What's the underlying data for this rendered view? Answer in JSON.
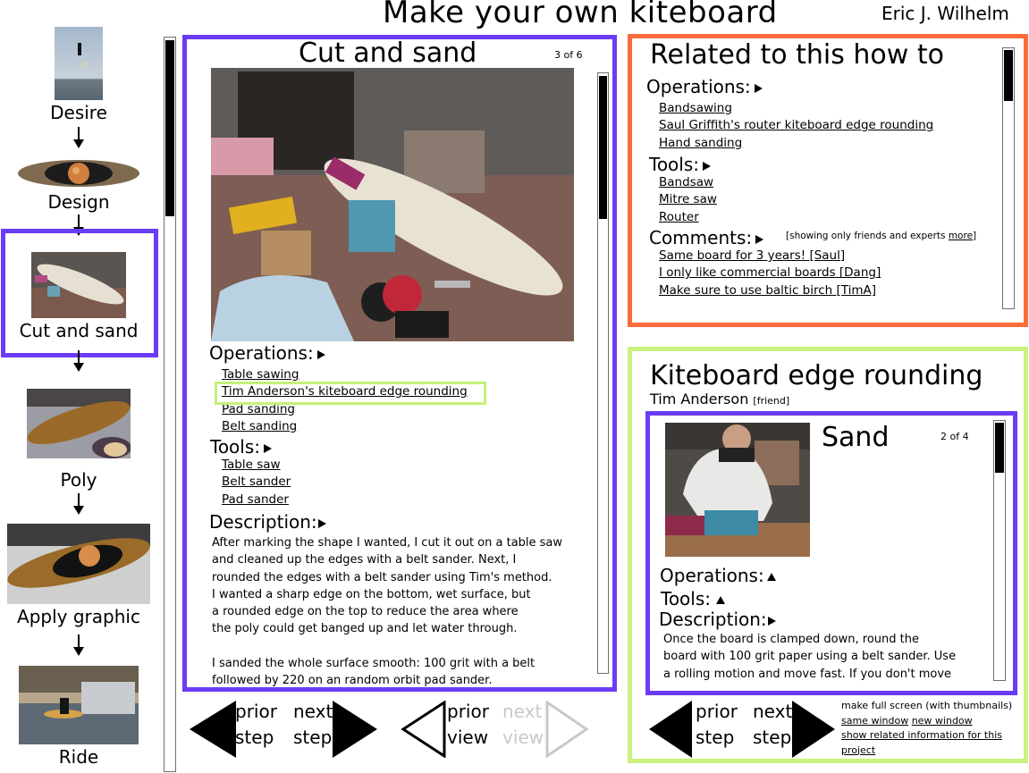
{
  "header": {
    "title": "Make your own kiteboard",
    "author": "Eric J. Wilhelm"
  },
  "steps": [
    {
      "label": "Desire",
      "thumbnail": "kiteboarder-jumping-photo"
    },
    {
      "label": "Design",
      "thumbnail": "board-design-graphic"
    },
    {
      "label": "Cut and sand",
      "thumbnail": "cut-board-photo",
      "current": true
    },
    {
      "label": "Poly",
      "thumbnail": "poly-board-photo"
    },
    {
      "label": "Apply graphic",
      "thumbnail": "graphic-board-photo"
    },
    {
      "label": "Ride",
      "thumbnail": "riding-photo"
    }
  ],
  "step_list_scroll": 0.3,
  "main": {
    "title": "Cut and sand",
    "counter": "3 of 6",
    "photo": "workshop-board-tools-photo",
    "operations_label": "Operations:",
    "operations": [
      "Table sawing",
      "Tim Anderson's kiteboard edge rounding",
      "Pad sanding",
      "Belt sanding"
    ],
    "highlighted_operation": "Tim Anderson's kiteboard edge rounding",
    "tools_label": "Tools:",
    "tools": [
      "Table saw",
      "Belt sander",
      "Pad sander"
    ],
    "description_label": "Description:",
    "description_lines": [
      "After marking the shape I wanted, I cut it out on a table saw",
      "and cleaned up the edges with a belt sander.  Next, I",
      "rounded the edges with a belt sander using Tim's method.",
      "I wanted a sharp edge on the bottom, wet surface, but",
      "a rounded edge on the top to reduce the area where",
      "the poly could get banged up and let water through.",
      "",
      "I sanded the whole surface smooth:  100 grit with a belt",
      "followed by 220 on an random orbit pad  sander."
    ],
    "scroll": 0.2
  },
  "main_nav": {
    "prior_step": [
      "prior",
      "step"
    ],
    "next_step": [
      "next",
      "step"
    ],
    "prior_view": [
      "prior",
      "view"
    ],
    "next_view": [
      "next",
      "view"
    ],
    "next_view_disabled": true
  },
  "related": {
    "title": "Related to this how to",
    "operations_label": "Operations:",
    "operations": [
      "Bandsawing",
      "Saul Griffith's router kiteboard edge rounding",
      "Hand sanding"
    ],
    "tools_label": "Tools:",
    "tools": [
      "Bandsaw",
      "Mitre saw",
      "Router"
    ],
    "comments_label": "Comments:",
    "comments_note": "[showing only friends and experts ",
    "comments_more": "more",
    "comments_note_end": "]",
    "comments": [
      "Same board for 3 years! [Saul]",
      "I only like commercial boards [Dang]",
      "Make sure to use baltic birch [TimA]"
    ],
    "scroll": 0.2
  },
  "kiteboard": {
    "title": "Kiteboard edge rounding",
    "author": "Tim Anderson",
    "author_tag": "[friend]",
    "step_title": "Sand",
    "counter": "2 of 4",
    "photo": "person-belt-sanding-photo",
    "operations_label": "Operations:",
    "tools_label": "Tools:",
    "description_label": "Description:",
    "description_lines": [
      "Once the board is clamped down, round the",
      "board with 100 grit paper using a belt sander.  Use",
      "a rolling motion and move fast.  If you don't move"
    ],
    "scroll": 0.2,
    "nav": {
      "prior_step": [
        "prior",
        "step"
      ],
      "next_step": [
        "next",
        "step"
      ]
    },
    "fullscreen_label": "make full screen (with thumbnails)",
    "same_window": "same window",
    "new_window": "new window",
    "show_related": "show related information for this",
    "show_related_2": "project"
  },
  "colors": {
    "current_frame": "#6a3cf5",
    "related_frame": "#fb6a3a",
    "kiteboard_frame": "#c9f27f",
    "disabled": "#c8c8c8"
  }
}
